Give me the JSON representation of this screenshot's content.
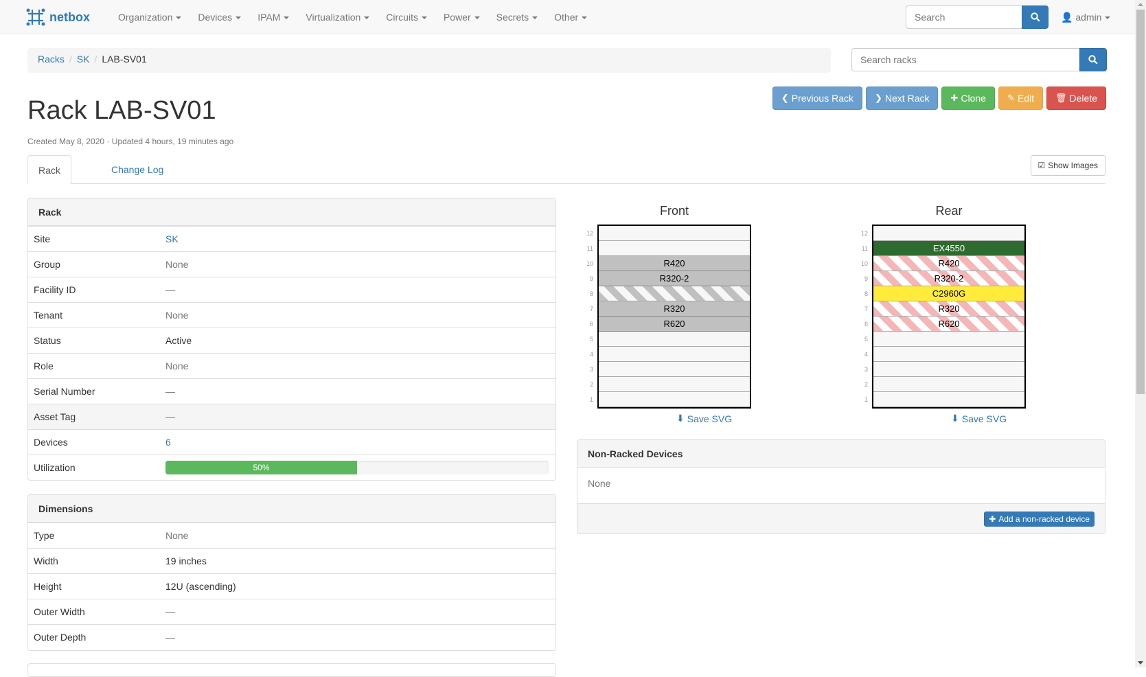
{
  "nav": {
    "brand": "netbox",
    "menu": [
      "Organization",
      "Devices",
      "IPAM",
      "Virtualization",
      "Circuits",
      "Power",
      "Secrets",
      "Other"
    ],
    "search_placeholder": "Search",
    "user": "admin"
  },
  "breadcrumb": [
    "Racks",
    "SK",
    "LAB-SV01"
  ],
  "rack_search_placeholder": "Search racks",
  "actions": {
    "previous": "Previous Rack",
    "next": "Next Rack",
    "clone": "Clone",
    "edit": "Edit",
    "delete": "Delete"
  },
  "title": "Rack LAB-SV01",
  "meta": "Created May 8, 2020 · Updated 4 hours, 19 minutes ago",
  "tabs": {
    "rack": "Rack",
    "changelog": "Change Log",
    "show_images": "Show Images"
  },
  "rack_panel": {
    "heading": "Rack",
    "rows": [
      {
        "k": "Site",
        "v": "SK"
      },
      {
        "k": "Group",
        "v": "None"
      },
      {
        "k": "Facility ID",
        "v": "—"
      },
      {
        "k": "Tenant",
        "v": "None"
      },
      {
        "k": "Status",
        "v": "Active"
      },
      {
        "k": "Role",
        "v": "None"
      },
      {
        "k": "Serial Number",
        "v": "—"
      },
      {
        "k": "Asset Tag",
        "v": "—"
      },
      {
        "k": "Devices",
        "v": "6"
      },
      {
        "k": "Utilization",
        "v": "50%"
      }
    ],
    "utilization_percent": 50
  },
  "dimensions_panel": {
    "heading": "Dimensions",
    "rows": [
      {
        "k": "Type",
        "v": "None"
      },
      {
        "k": "Width",
        "v": "19 inches"
      },
      {
        "k": "Height",
        "v": "12U (ascending)"
      },
      {
        "k": "Outer Width",
        "v": "—"
      },
      {
        "k": "Outer Depth",
        "v": "—"
      }
    ]
  },
  "elevations": {
    "front_title": "Front",
    "rear_title": "Rear",
    "save_svg": "Save SVG",
    "unit_numbers": [
      "12",
      "11",
      "10",
      "9",
      "8",
      "7",
      "6",
      "5",
      "4",
      "3",
      "2",
      "1"
    ],
    "front_units": [
      "",
      "",
      "R420",
      "R320-2",
      "",
      "R320",
      "R620",
      "",
      "",
      "",
      "",
      ""
    ],
    "rear_units": [
      "",
      "EX4550",
      "R420",
      "R320-2",
      "C2960G",
      "R320",
      "R620",
      "",
      "",
      "",
      "",
      ""
    ]
  },
  "non_racked": {
    "heading": "Non-Racked Devices",
    "body": "None",
    "add_button": "Add a non-racked device"
  },
  "colors": {
    "primary": "#337ab7",
    "success": "#5cb85c",
    "warning": "#f0ad4e",
    "danger": "#d9534f",
    "device_green": "#2e6b2e",
    "device_yellow": "#ffeb3b"
  }
}
